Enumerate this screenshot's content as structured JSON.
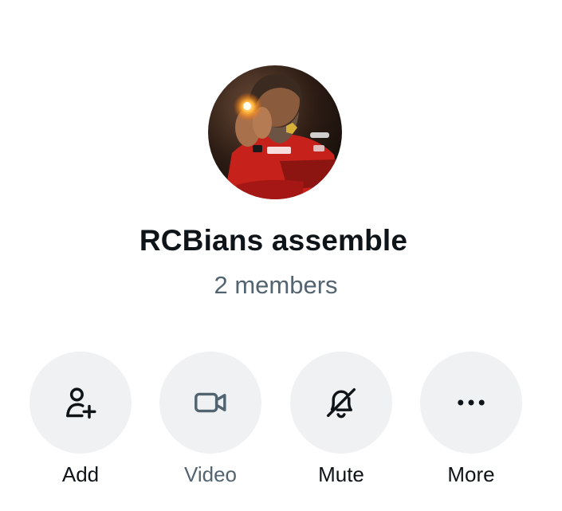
{
  "group": {
    "name": "RCBians assemble",
    "members": "2 members"
  },
  "actions": [
    {
      "label": "Add",
      "icon": "add-user-icon"
    },
    {
      "label": "Video",
      "icon": "video-camera-icon"
    },
    {
      "label": "Mute",
      "icon": "bell-muted-icon"
    },
    {
      "label": "More",
      "icon": "more-dots-icon"
    }
  ],
  "colors": {
    "primary_text": "#0f1419",
    "secondary_text": "#536471",
    "button_bg": "#eff1f3"
  }
}
